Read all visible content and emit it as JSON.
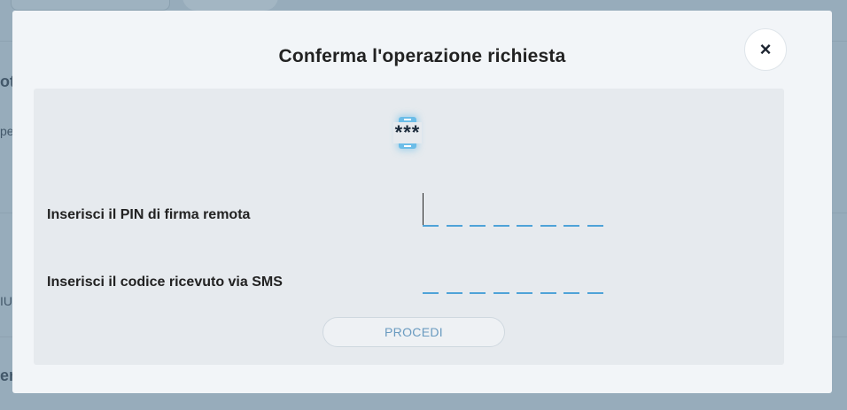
{
  "background": {
    "fragments": [
      "ota",
      "pe",
      "IU",
      "er"
    ]
  },
  "modal": {
    "title": "Conferma l'operazione richiesta",
    "close_label": "×",
    "icon_screen_text": "***",
    "pin_label": "Inserisci il PIN di firma remota",
    "sms_label": "Inserisci il codice ricevuto via SMS",
    "pin_length": 8,
    "submit_label": "PROCEDI"
  },
  "colors": {
    "accent": "#4fa3d8",
    "overlay": "#97acbb",
    "modal_bg": "#f2f5f8",
    "panel_bg": "#e6eaee"
  },
  "icons": {
    "close": "close-icon",
    "phone": "smartphone-password-icon"
  }
}
